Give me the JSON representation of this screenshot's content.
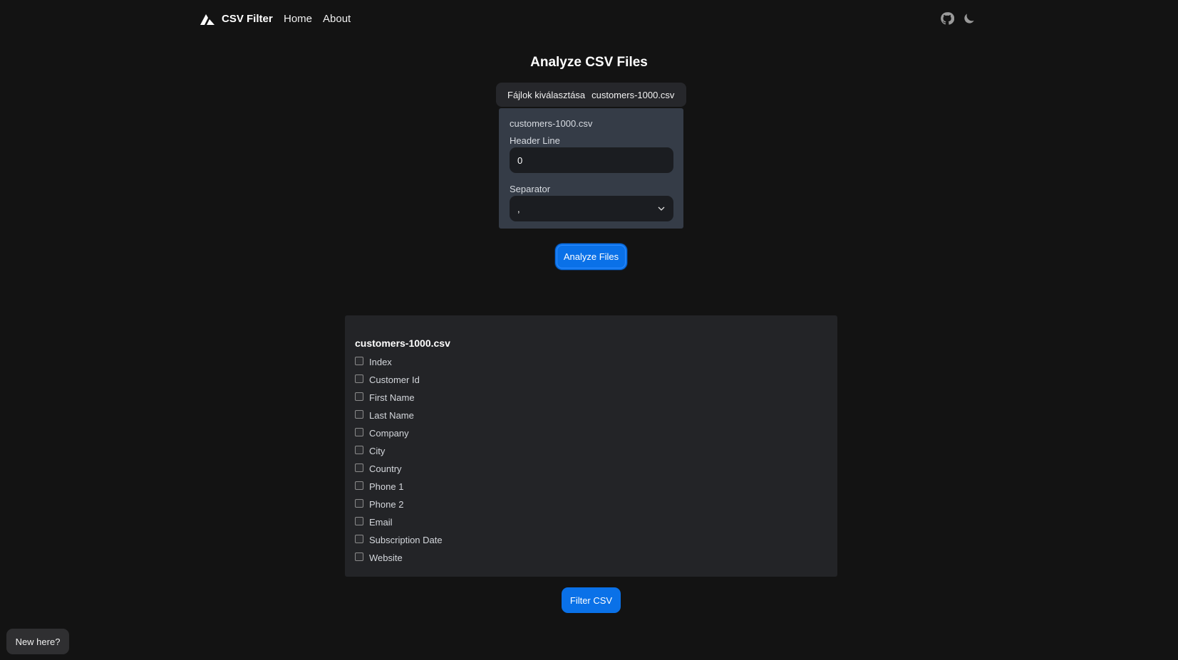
{
  "header": {
    "brand": "CSV Filter",
    "nav": [
      "Home",
      "About"
    ],
    "icons": [
      "github-icon",
      "moon-icon"
    ]
  },
  "page": {
    "title": "Analyze CSV Files"
  },
  "file_input": {
    "button_label": "Fájlok kiválasztása",
    "selected_file": "customers-1000.csv"
  },
  "settings": {
    "file_name": "customers-1000.csv",
    "header_line_label": "Header Line",
    "header_line_value": "0",
    "separator_label": "Separator",
    "separator_value": ","
  },
  "analyze_button": "Analyze Files",
  "columns": {
    "file_name": "customers-1000.csv",
    "items": [
      "Index",
      "Customer Id",
      "First Name",
      "Last Name",
      "Company",
      "City",
      "Country",
      "Phone 1",
      "Phone 2",
      "Email",
      "Subscription Date",
      "Website"
    ]
  },
  "filter_button": "Filter CSV",
  "help_button": "New here?",
  "colors": {
    "background": "#131313",
    "accent": "#0a71e8",
    "card": "#232427",
    "settings_card": "#353c47"
  }
}
